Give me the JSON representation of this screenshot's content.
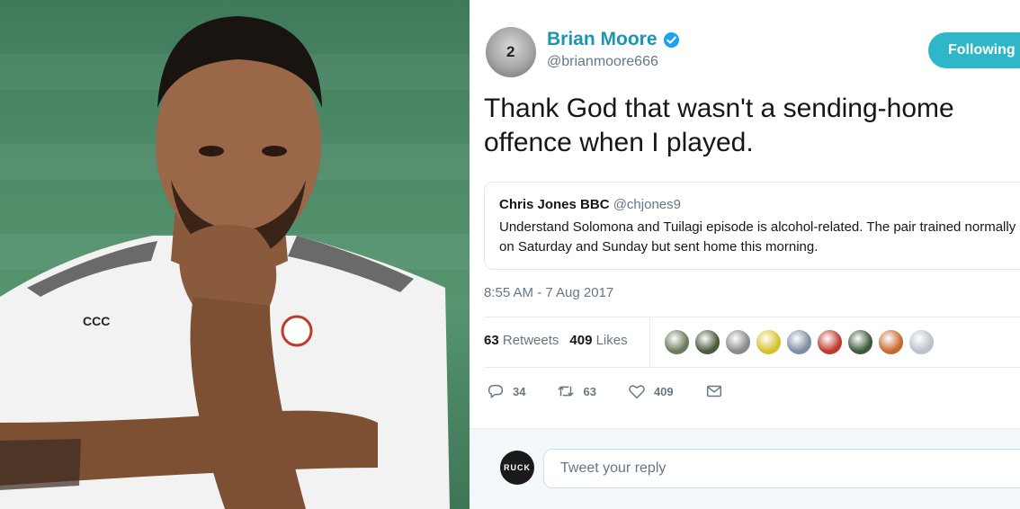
{
  "photo": {
    "icon": "rugby-player-photo"
  },
  "tweet": {
    "author": {
      "name": "Brian Moore",
      "handle": "@brianmoore666",
      "avatar_number": "2",
      "verified": true
    },
    "follow_label": "Following",
    "text": "Thank God that wasn't a sending-home offence when I played.",
    "quoted": {
      "name": "Chris Jones BBC",
      "handle": "@chjones9",
      "text": "Understand Solomona and Tuilagi episode is alcohol-related. The pair trained normally on Saturday and Sunday but sent home this morning."
    },
    "timestamp": "8:55 AM - 7 Aug 2017",
    "stats": {
      "retweets_count": "63",
      "retweets_label": "Retweets",
      "likes_count": "409",
      "likes_label": "Likes"
    },
    "likers": [
      "#6b7a5a",
      "#4a5a3c",
      "#8a8a8a",
      "#d7c22c",
      "#7d8ea3",
      "#c0392b",
      "#3c5a3a",
      "#c8692c",
      "#b9c2ca"
    ],
    "actions": {
      "reply_count": "34",
      "retweet_count": "63",
      "like_count": "409"
    },
    "reply": {
      "avatar_text": "RUCK",
      "placeholder": "Tweet your reply"
    }
  },
  "colors": {
    "accent": "#1b95b3",
    "follow_bg": "#2fb7c7",
    "muted": "#657786"
  }
}
